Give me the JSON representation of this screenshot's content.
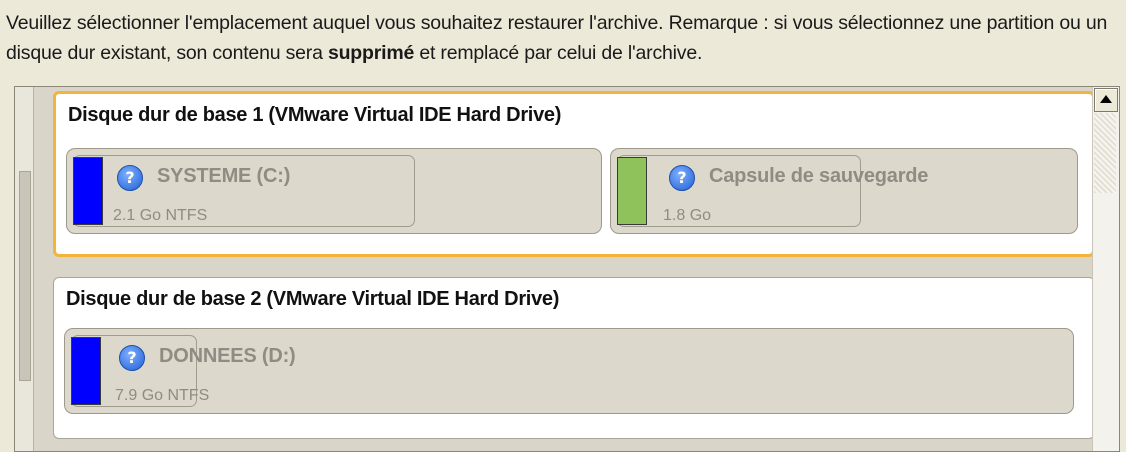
{
  "instructions": {
    "text_before": "Veuillez sélectionner l'emplacement auquel vous souhaitez restaurer l'archive. Remarque : si vous sélectionnez une partition ou un disque dur existant, son contenu sera ",
    "bold": "supprimé",
    "text_after": " et remplacé par celui de l'archive."
  },
  "disks": [
    {
      "title": "Disque dur de base 1 (VMware Virtual IDE Hard Drive)",
      "selected": true,
      "partitions": [
        {
          "name": "SYSTEME (C:)",
          "info": "2.1 Go NTFS",
          "color": "#0000ff",
          "icon": "help-icon"
        },
        {
          "name": "Capsule de sauvegarde",
          "info": "1.8 Go",
          "color": "#8fc25a",
          "icon": "help-icon"
        }
      ]
    },
    {
      "title": "Disque dur de base 2 (VMware Virtual IDE Hard Drive)",
      "selected": false,
      "partitions": [
        {
          "name": "DONNEES (D:)",
          "info": "7.9 Go NTFS",
          "color": "#0000ff",
          "icon": "help-icon"
        }
      ]
    }
  ],
  "colors": {
    "selection_border": "#f2b43a",
    "window_bg": "#ece9d8"
  },
  "icons": {
    "help": "?",
    "scroll_up": "scroll-up-arrow-icon"
  }
}
